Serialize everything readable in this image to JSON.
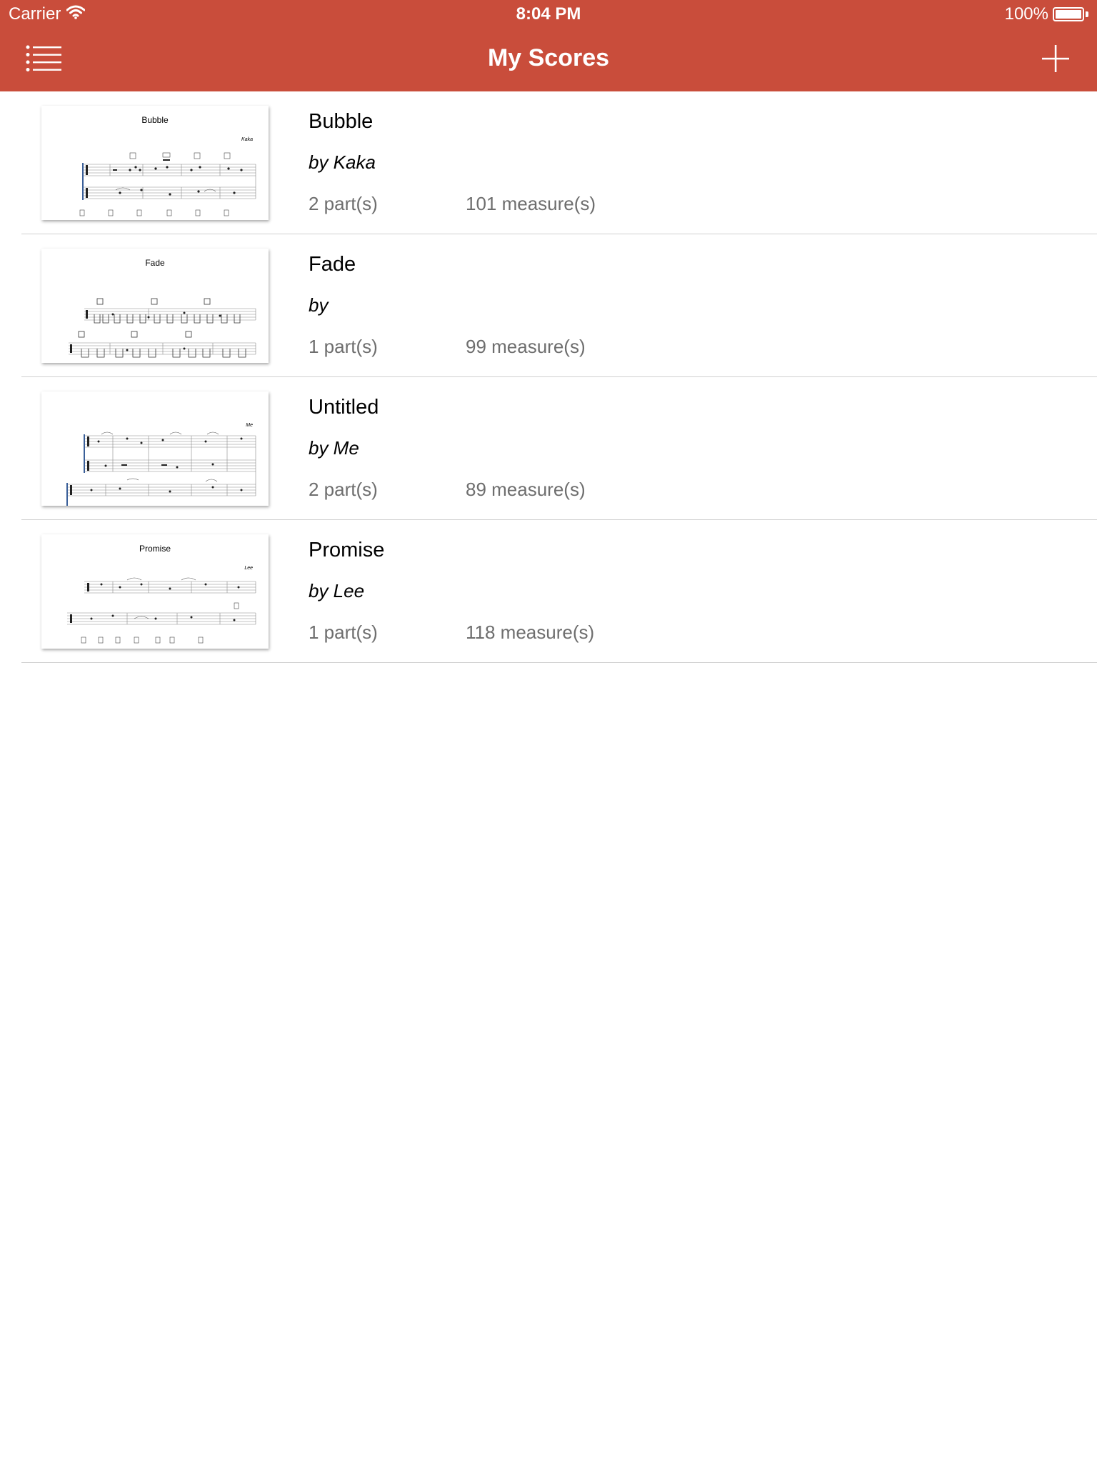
{
  "status_bar": {
    "carrier": "Carrier",
    "time": "8:04 PM",
    "battery": "100%",
    "battery_level": 1.0,
    "wifi_icon": "wifi-icon",
    "battery_icon": "battery-icon"
  },
  "nav": {
    "title": "My Scores",
    "menu_icon": "list-menu-icon",
    "add_icon": "plus-icon"
  },
  "colors": {
    "header": "#c94d3b",
    "divider": "#d0d0d0",
    "meta_text": "#6e6e6e"
  },
  "scores": [
    {
      "title": "Bubble",
      "author": "by Kaka",
      "parts": "2 part(s)",
      "measures": "101 measure(s)",
      "thumb_title": "Bubble",
      "thumb_composer": "Kaka"
    },
    {
      "title": "Fade",
      "author": "by",
      "parts": "1 part(s)",
      "measures": "99 measure(s)",
      "thumb_title": "Fade",
      "thumb_composer": ""
    },
    {
      "title": "Untitled",
      "author": "by Me",
      "parts": "2 part(s)",
      "measures": "89 measure(s)",
      "thumb_title": "",
      "thumb_composer": "Me"
    },
    {
      "title": "Promise",
      "author": "by Lee",
      "parts": "1 part(s)",
      "measures": "118 measure(s)",
      "thumb_title": "Promise",
      "thumb_composer": "Lee"
    }
  ]
}
